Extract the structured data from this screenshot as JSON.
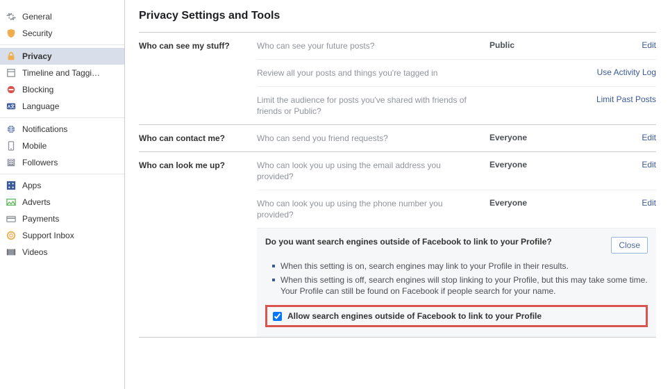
{
  "sidebar": {
    "groups": [
      {
        "items": [
          {
            "label": "General",
            "iconColor": "#90949c"
          },
          {
            "label": "Security",
            "iconColor": "#f0ad4e"
          }
        ]
      },
      {
        "items": [
          {
            "label": "Privacy",
            "iconColor": "#f0ad4e",
            "active": true
          },
          {
            "label": "Timeline and Taggi…",
            "iconColor": "#90949c"
          },
          {
            "label": "Blocking",
            "iconColor": "#d9534f"
          },
          {
            "label": "Language",
            "iconColor": "#3b5998"
          }
        ]
      },
      {
        "items": [
          {
            "label": "Notifications",
            "iconColor": "#6d84b4"
          },
          {
            "label": "Mobile",
            "iconColor": "#90949c"
          },
          {
            "label": "Followers",
            "iconColor": "#90949c"
          }
        ]
      },
      {
        "items": [
          {
            "label": "Apps",
            "iconColor": "#3b5998"
          },
          {
            "label": "Adverts",
            "iconColor": "#5cb85c"
          },
          {
            "label": "Payments",
            "iconColor": "#90949c"
          },
          {
            "label": "Support Inbox",
            "iconColor": "#f0ad4e"
          },
          {
            "label": "Videos",
            "iconColor": "#90949c"
          }
        ]
      }
    ]
  },
  "page": {
    "title": "Privacy Settings and Tools",
    "sections": [
      {
        "label": "Who can see my stuff?",
        "rows": [
          {
            "desc": "Who can see your future posts?",
            "value": "Public",
            "action": "Edit"
          },
          {
            "desc": "Review all your posts and things you're tagged in",
            "value": "",
            "action": "Use Activity Log"
          },
          {
            "desc": "Limit the audience for posts you've shared with friends of friends or Public?",
            "value": "",
            "action": "Limit Past Posts"
          }
        ]
      },
      {
        "label": "Who can contact me?",
        "rows": [
          {
            "desc": "Who can send you friend requests?",
            "value": "Everyone",
            "action": "Edit"
          }
        ]
      },
      {
        "label": "Who can look me up?",
        "rows": [
          {
            "desc": "Who can look you up using the email address you provided?",
            "value": "Everyone",
            "action": "Edit"
          },
          {
            "desc": "Who can look you up using the phone number you provided?",
            "value": "Everyone",
            "action": "Edit"
          }
        ],
        "expanded": {
          "title": "Do you want search engines outside of Facebook to link to your Profile?",
          "close": "Close",
          "bullets": [
            "When this setting is on, search engines may link to your Profile in their results.",
            "When this setting is off, search engines will stop linking to your Profile, but this may take some time. Your Profile can still be found on Facebook if people search for your name."
          ],
          "checkbox_label": "Allow search engines outside of Facebook to link to your Profile",
          "checkbox_checked": true
        }
      }
    ]
  }
}
